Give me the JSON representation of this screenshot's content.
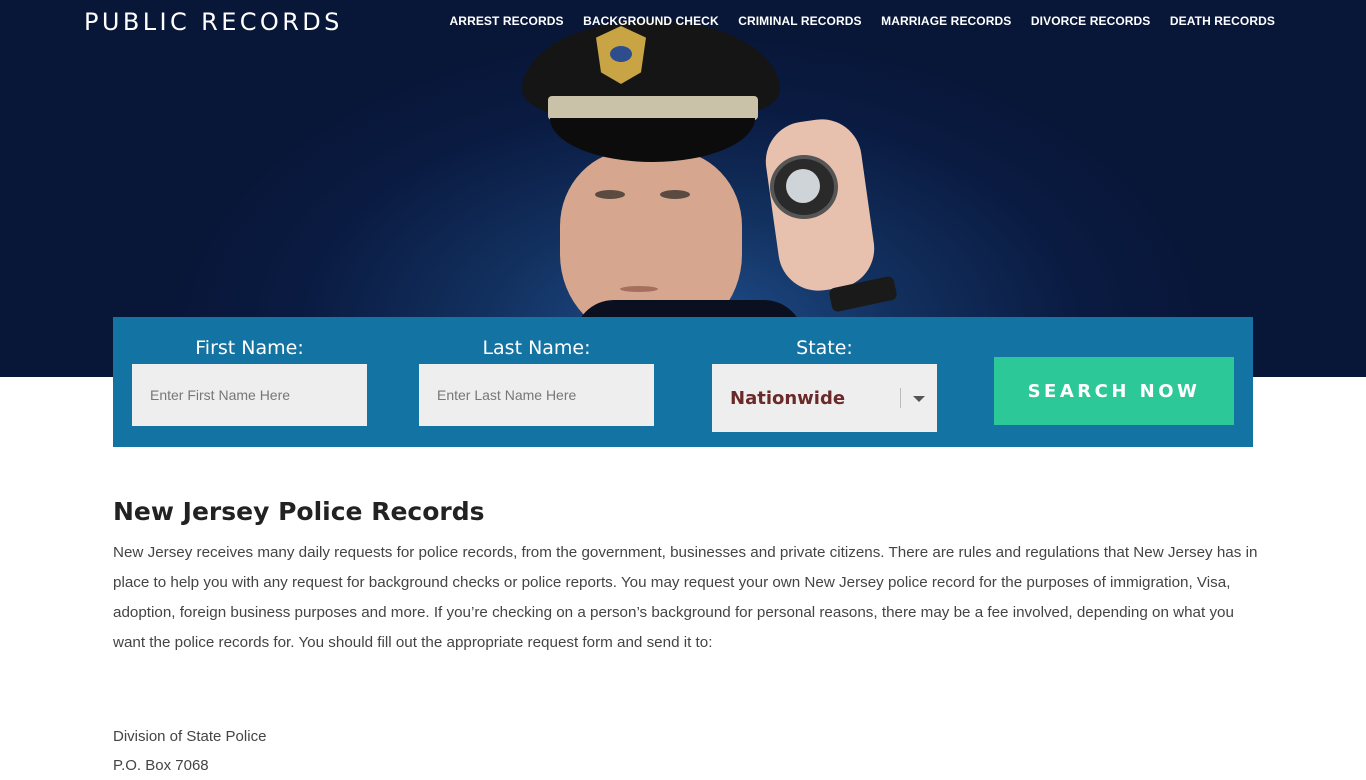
{
  "header": {
    "logo": "PUBLIC RECORDS",
    "nav": [
      "ARREST RECORDS",
      "BACKGROUND CHECK",
      "CRIMINAL RECORDS",
      "MARRIAGE RECORDS",
      "DIVORCE RECORDS",
      "DEATH RECORDS"
    ]
  },
  "search": {
    "first_name_label": "First Name:",
    "first_name_placeholder": "Enter First Name Here",
    "last_name_label": "Last Name:",
    "last_name_placeholder": "Enter Last Name Here",
    "state_label": "State:",
    "state_value": "Nationwide",
    "button_label": "SEARCH NOW"
  },
  "article": {
    "title": "New Jersey Police Records",
    "body": "New Jersey receives many daily requests for police records, from the government, businesses and private citizens. There are rules and regulations that New Jersey has in place to help you with any request for background checks or police reports. You may request your own New Jersey police record for the purposes of immigration, Visa, adoption, foreign business purposes and more. If you’re checking on a person’s background for personal reasons, there may be a fee involved, depending on what you want the police records for. You should fill out the appropriate request form and send it to:",
    "address_line1": "Division of State Police",
    "address_line2": "P.O. Box 7068"
  },
  "colors": {
    "hero_bg": "#0a1b42",
    "search_bar": "#1373a2",
    "button": "#2dc897",
    "select_text": "#6b2a2a"
  }
}
